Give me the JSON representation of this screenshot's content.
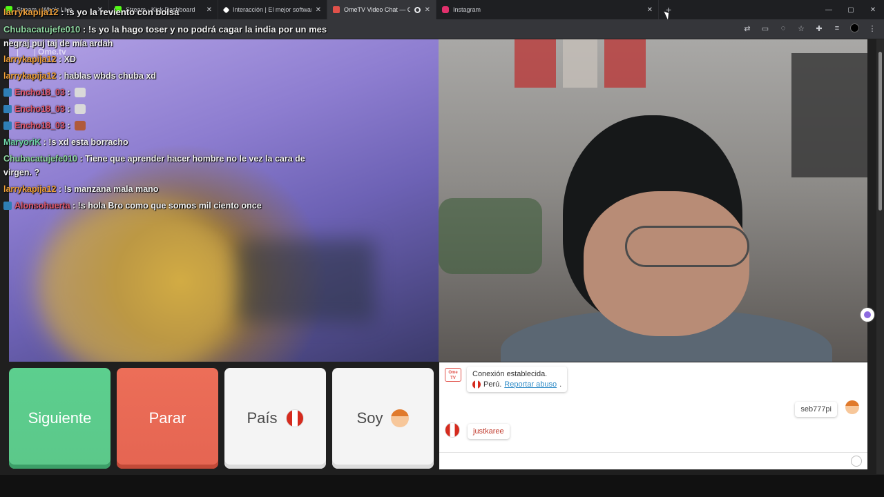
{
  "browser": {
    "tabs": [
      {
        "title": "Stream - Who's Live",
        "fav_color": "#53fc18"
      },
      {
        "title": "Stream - Kick Dashboard",
        "fav_color": "#53fc18"
      },
      {
        "title": "Interacción | El mejor software",
        "fav_color": "#ffffff"
      },
      {
        "title": "OmeTV Video Chat — Ome",
        "fav_color": "#e1514a",
        "active": true
      },
      {
        "title": "Instagram",
        "fav_color": "#e1306c"
      }
    ],
    "new_tab": "+",
    "window_controls": [
      "—",
      "▢",
      "✕"
    ]
  },
  "stream_chat": {
    "top_line": {
      "user": "larrykapija12",
      "text": "!s yo la reviento con bolsa",
      "user_color": "#f0a13a"
    },
    "messages": [
      {
        "user": "Chubacatujefe010",
        "text": "!s yo la hago toser y no podrá cagar la india por un mes",
        "user_color": "#8fd7a1"
      },
      {
        "user": "",
        "text": "negraj puj taj de mía ardah",
        "user_color": "#ffffff"
      },
      {
        "user": "larrykapija12",
        "text": "XD",
        "user_color": "#f0a13a"
      },
      {
        "user": "larrykapija12",
        "text": "hablas wbds chuba xd",
        "user_color": "#f0a13a"
      },
      {
        "user": "Encho18_03",
        "text": "",
        "user_color": "#e0586f",
        "badge": true,
        "emote": "#d9d9d9"
      },
      {
        "user": "Encho18_03",
        "text": "",
        "user_color": "#e0586f",
        "badge": true,
        "emote": "#d9d9d9"
      },
      {
        "user": "Encho18_03",
        "text": "",
        "user_color": "#e0586f",
        "badge": true,
        "emote": "#b05a3a"
      },
      {
        "user": "MaryoriK",
        "text": "!s xd esta borracho",
        "user_color": "#6fd3a8"
      },
      {
        "user": "Chubacatujefe010",
        "text": "Tiene que aprender hacer hombre no le vez la cara de virgen. ?",
        "user_color": "#8fd7a1"
      },
      {
        "user": "larrykapija12",
        "text": "!s manzana mala mano",
        "user_color": "#f0a13a"
      },
      {
        "user": "Alonsohuerta",
        "text": "!s hola Bro como que somos mil ciento once",
        "user_color": "#e0586f",
        "badge": true
      }
    ]
  },
  "video": {
    "left_logo": "Ome.tv"
  },
  "controls": {
    "next": "Siguiente",
    "stop": "Parar",
    "country": "País",
    "gender": "Soy"
  },
  "site_chat": {
    "logo_text": "Ome TV",
    "system_line1": "Conexión establecida.",
    "system_country": "Perú.",
    "system_link": "Reportar abuso",
    "my_name": "seb777pi",
    "stranger_name": "justkaree"
  }
}
